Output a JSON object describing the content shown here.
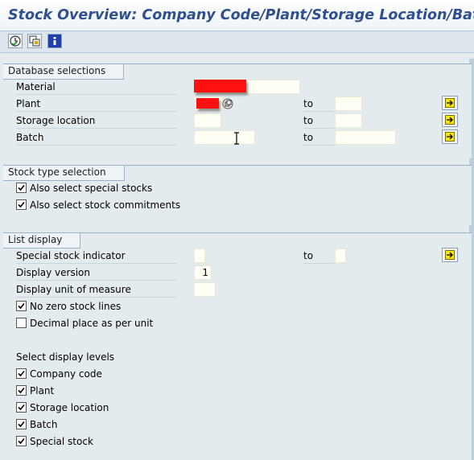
{
  "title": "Stock Overview: Company Code/Plant/Storage Location/Batch",
  "toolbar": {
    "icons": [
      "execute-icon",
      "multiple-selection-icon",
      "information-icon"
    ]
  },
  "database_selections": {
    "title": "Database selections",
    "material_label": "Material",
    "plant_label": "Plant",
    "storage_location_label": "Storage location",
    "batch_label": "Batch",
    "to_label": "to"
  },
  "stock_type_selection": {
    "title": "Stock type selection",
    "special_stocks": {
      "label": "Also select special stocks",
      "checked": true
    },
    "stock_commitments": {
      "label": "Also select stock commitments",
      "checked": true
    }
  },
  "list_display": {
    "title": "List display",
    "special_stock_indicator_label": "Special stock indicator",
    "display_version_label": "Display version",
    "display_version_value": "1",
    "display_unit_label": "Display unit of measure",
    "to_label": "to",
    "no_zero_stock": {
      "label": "No zero stock lines",
      "checked": true
    },
    "decimal_place": {
      "label": "Decimal place as per unit",
      "checked": false
    },
    "select_levels_label": "Select display levels",
    "levels": [
      {
        "label": "Company code",
        "checked": true
      },
      {
        "label": "Plant",
        "checked": true
      },
      {
        "label": "Storage location",
        "checked": true
      },
      {
        "label": "Batch",
        "checked": true
      },
      {
        "label": "Special stock",
        "checked": true
      }
    ]
  },
  "colors": {
    "title": "#2f4f8f",
    "background": "#e3ebef",
    "input": "#fffff6",
    "redaction": "#ff1010"
  }
}
